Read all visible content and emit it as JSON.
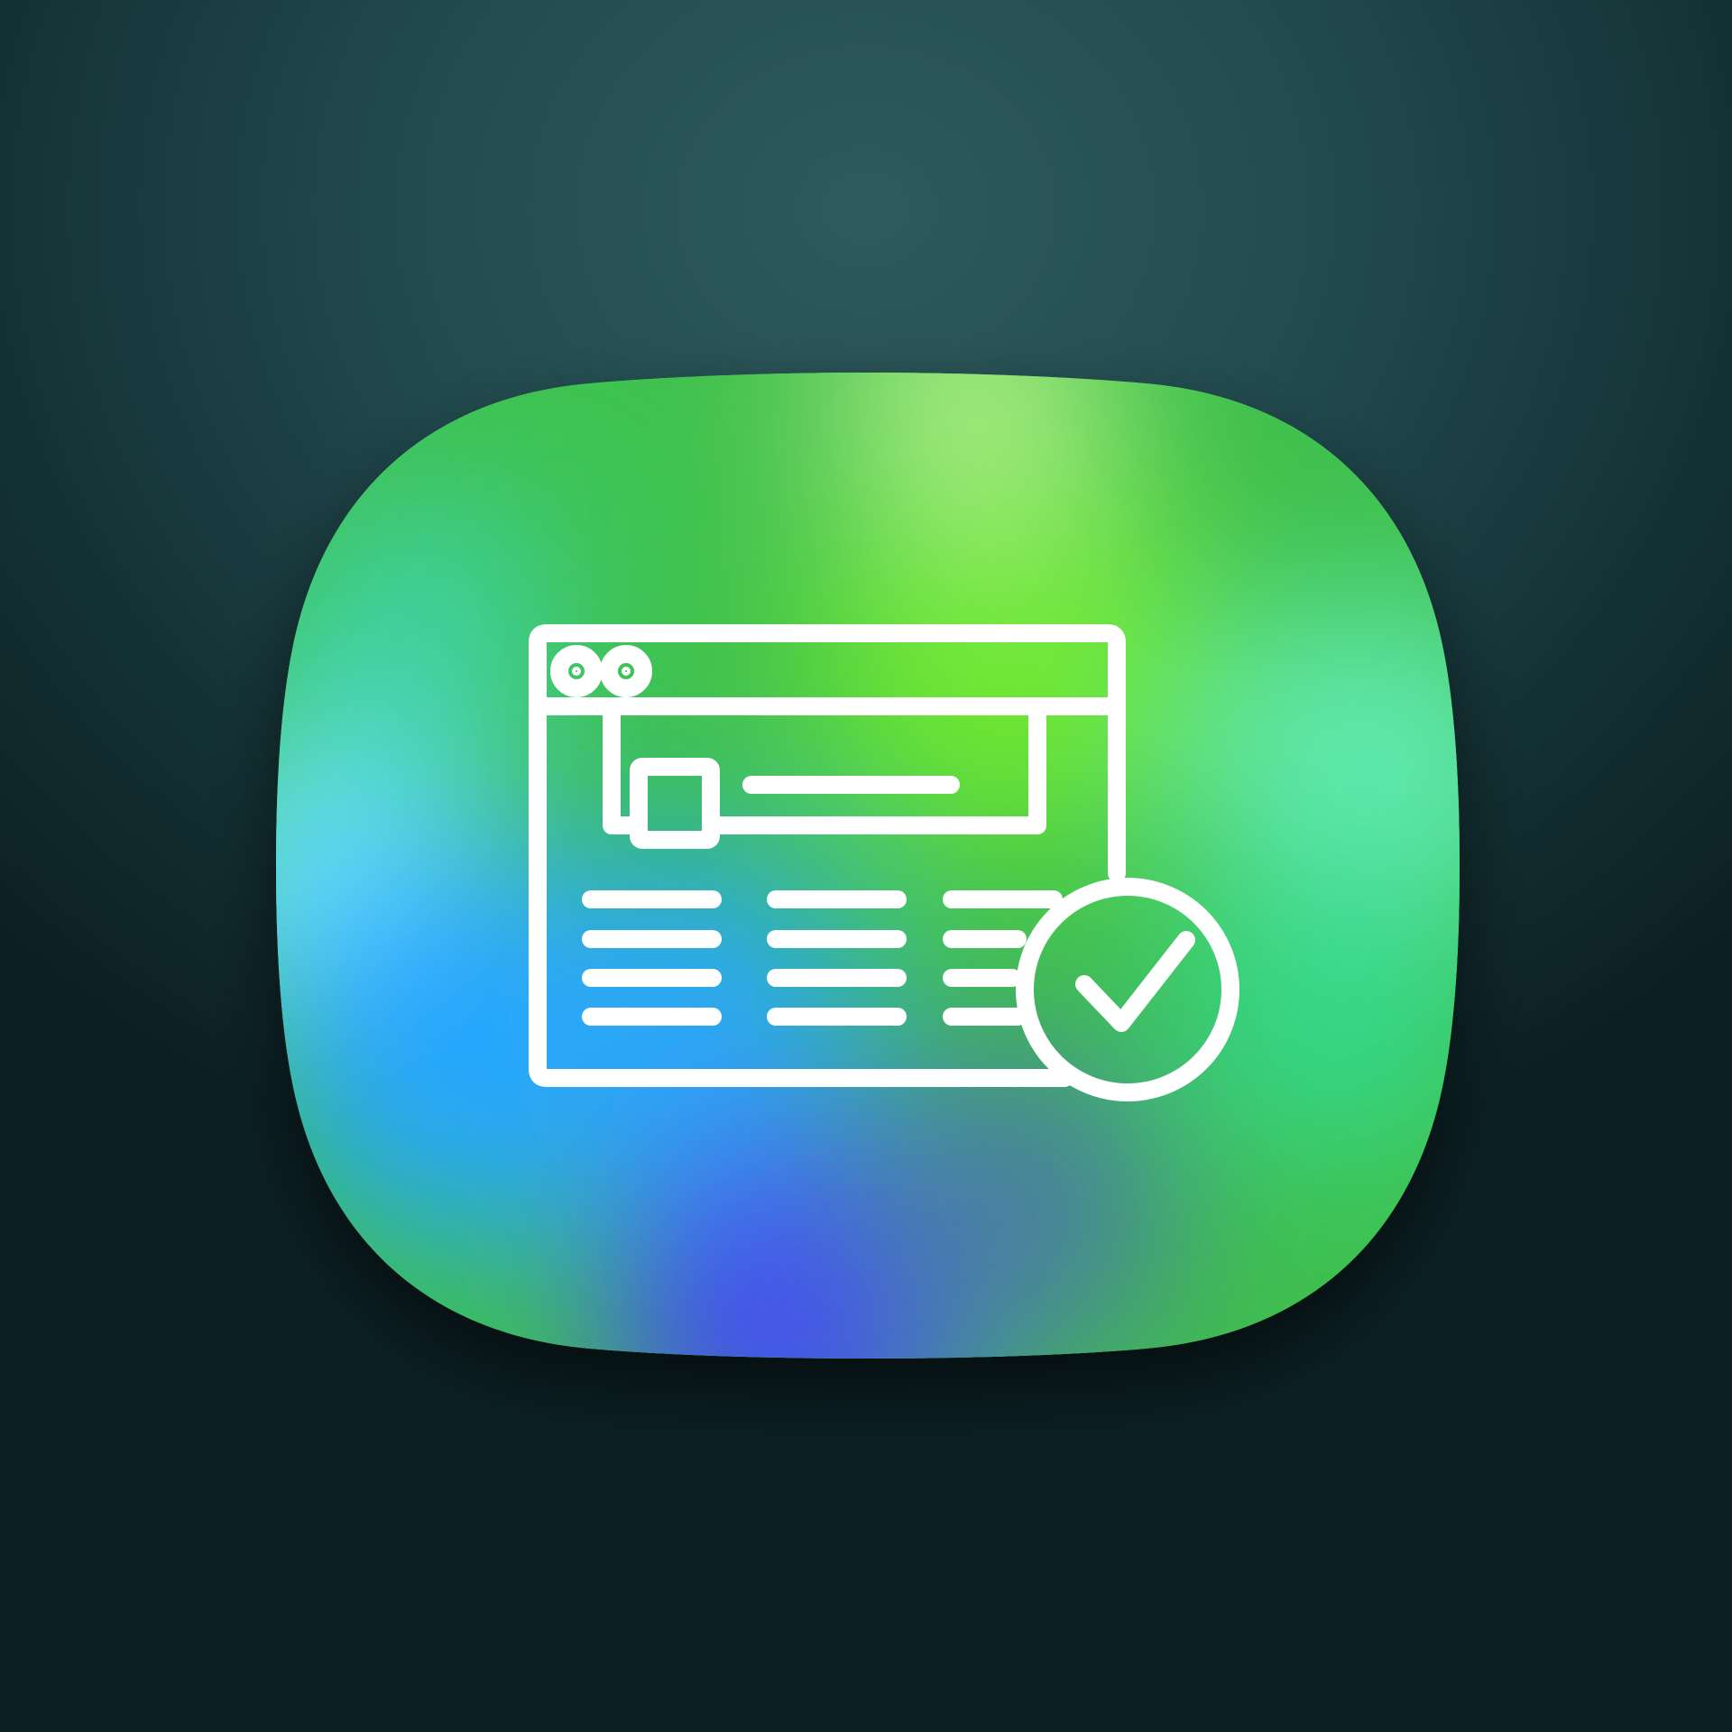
{
  "icon": {
    "name": "website-approved-app-icon",
    "shape": "squircle",
    "glyph": "browser-window-check-icon"
  },
  "colors": {
    "background_center": "#2f5b5c",
    "background_edge": "#0c2024",
    "squircle_green": "#3ebf4a",
    "squircle_lime": "#6fe833",
    "squircle_light_lime": "#a6ea80",
    "squircle_mint": "#60e9b0",
    "squircle_cyan": "#6ee6ff",
    "squircle_blue": "#26a6ff",
    "squircle_violet": "#4550f0",
    "glyph_stroke": "#ffffff"
  }
}
